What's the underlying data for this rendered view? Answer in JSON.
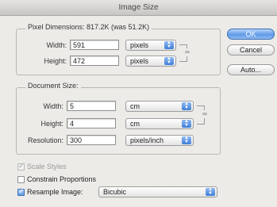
{
  "window": {
    "title": "Image Size"
  },
  "pixel_dimensions": {
    "legend": "Pixel Dimensions:  817.2K (was 51.2K)",
    "width": {
      "label": "Width:",
      "value": "591",
      "unit": "pixels"
    },
    "height": {
      "label": "Height:",
      "value": "472",
      "unit": "pixels"
    }
  },
  "document_size": {
    "legend": "Document Size:",
    "width": {
      "label": "Width:",
      "value": "5",
      "unit": "cm"
    },
    "height": {
      "label": "Height:",
      "value": "4",
      "unit": "cm"
    },
    "resolution": {
      "label": "Resolution:",
      "value": "300",
      "unit": "pixels/inch"
    }
  },
  "options": {
    "scale_styles": {
      "label": "Scale Styles",
      "checked": true,
      "disabled": true
    },
    "constrain_proportions": {
      "label": "Constrain Proportions",
      "checked": false
    },
    "resample_image": {
      "label": "Resample Image:",
      "checked": true,
      "method": "Bicubic"
    }
  },
  "buttons": {
    "ok": "OK",
    "cancel": "Cancel",
    "auto": "Auto..."
  },
  "colors": {
    "accent": "#5f9ae6",
    "background": "#ecebe8"
  }
}
